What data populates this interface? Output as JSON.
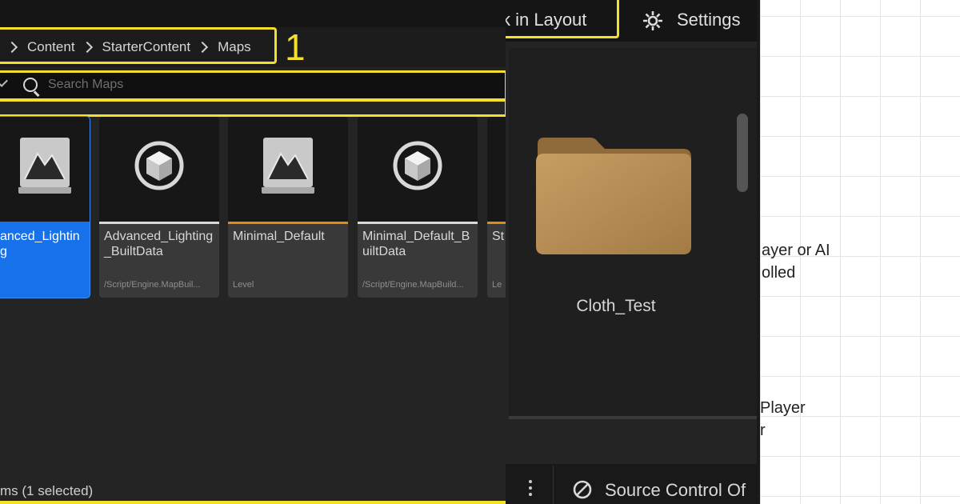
{
  "browser": {
    "breadcrumb": [
      "Content",
      "StarterContent",
      "Maps"
    ],
    "annotation_number": "1",
    "search": {
      "placeholder": "Search Maps",
      "value": ""
    },
    "assets": [
      {
        "name": "anced_Lighting",
        "path": "",
        "icon": "level-icon",
        "bar_color": "#1671ea",
        "selected": true
      },
      {
        "name": "Advanced_Lighting_BuiltData",
        "path": "/Script/Engine.MapBuil...",
        "icon": "map-build-data-icon",
        "bar_color": "#d9d9d9",
        "selected": false
      },
      {
        "name": "Minimal_Default",
        "path": "Level",
        "icon": "level-icon",
        "bar_color": "#e38a12",
        "selected": false
      },
      {
        "name": "Minimal_Default_BuiltData",
        "path": "/Script/Engine.MapBuild...",
        "icon": "map-build-data-icon",
        "bar_color": "#d9d9d9",
        "selected": false
      },
      {
        "name": "St",
        "path": "Le",
        "icon": "level-icon",
        "bar_color": "#e38a12",
        "selected": false
      }
    ],
    "status": "ms (1 selected)"
  },
  "folder_view": {
    "dock_label": "ck in Layout",
    "settings_label": "Settings",
    "folder_name": "Cloth_Test",
    "source_control_label": "Source Control Of"
  },
  "diagram": {
    "text_1_line_1": "ayer or AI",
    "text_1_line_2": "olled",
    "text_2_line_1": "Player",
    "text_2_line_2": "r"
  },
  "colors": {
    "highlight": "#f4df2c",
    "selection": "#1671ea",
    "level_bar": "#e38a12",
    "folder": "#b68a4f"
  }
}
